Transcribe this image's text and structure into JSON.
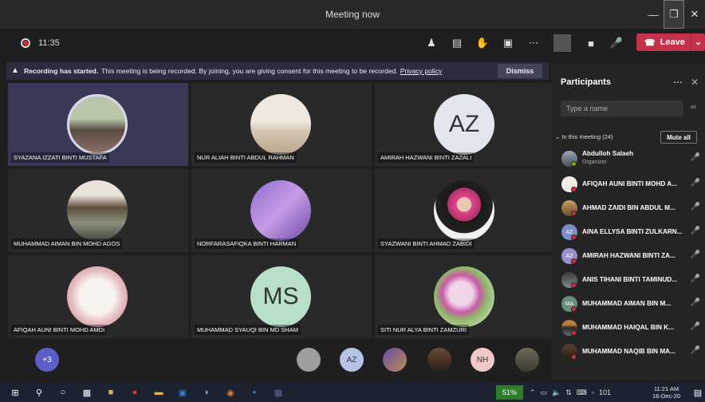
{
  "window": {
    "title": "Meeting now"
  },
  "toolbar": {
    "timer": "11:35",
    "leave_label": "Leave"
  },
  "banner": {
    "bold": "Recording has started.",
    "text": "This meeting is being recorded. By joining, you are giving consent for this meeting to be recorded.",
    "link": "Privacy policy",
    "dismiss": "Dismiss"
  },
  "tiles": [
    {
      "name": "SYAZANA IZZATI BINTI MUSTAFA",
      "initials": ""
    },
    {
      "name": "NUR ALIAH BINTI ABDUL RAHMAN",
      "initials": ""
    },
    {
      "name": "AMIRAH HAZWANI BINTI ZAZALI",
      "initials": "AZ"
    },
    {
      "name": "MUHAMMAD AIMAN BIN MOHD AGOS",
      "initials": ""
    },
    {
      "name": "NORFARASAFIQKA BINTI HARMAN",
      "initials": ""
    },
    {
      "name": "SYAZWANI BINTI AHMAD ZABIDI",
      "initials": ""
    },
    {
      "name": "AFIQAH AUNI BINTI MOHD AMDI",
      "initials": ""
    },
    {
      "name": "MUHAMMAD SYAUQI BIN MD SHAM",
      "initials": "MS"
    },
    {
      "name": "SITI NUR ALYA BINTI ZAMZURI",
      "initials": ""
    }
  ],
  "overflow": {
    "more_count": "+3",
    "az": "AZ",
    "nh": "NH"
  },
  "participants": {
    "title": "Participants",
    "search_placeholder": "Type a name",
    "section": "In this meeting (24)",
    "mute_all": "Mute all",
    "list": [
      {
        "name": "Abdulloh Salaeh",
        "role": "Organizer",
        "initials": ""
      },
      {
        "name": "AFIQAH AUNI BINTI MOHD A...",
        "role": "",
        "initials": ""
      },
      {
        "name": "AHMAD ZAIDI BIN ABDUL M...",
        "role": "",
        "initials": ""
      },
      {
        "name": "AINA ELLYSA BINTI ZULKARN...",
        "role": "",
        "initials": "AZ"
      },
      {
        "name": "AMIRAH HAZWANI BINTI ZA...",
        "role": "",
        "initials": "AZ"
      },
      {
        "name": "ANIS TIHANI BINTI TAMINUD...",
        "role": "",
        "initials": ""
      },
      {
        "name": "MUHAMMAD AIMAN BIN M...",
        "role": "",
        "initials": "MA"
      },
      {
        "name": "MUHAMMAD HAIQAL BIN K...",
        "role": "",
        "initials": ""
      },
      {
        "name": "MUHAMMAD NAQIB BIN MA...",
        "role": "",
        "initials": ""
      }
    ]
  },
  "taskbar": {
    "battery": "51%",
    "time": "11:21 AM",
    "date": "16-Dec-20",
    "temp": "101"
  },
  "colors": {
    "leave": "#c4314b",
    "accent": "#6264a7"
  }
}
